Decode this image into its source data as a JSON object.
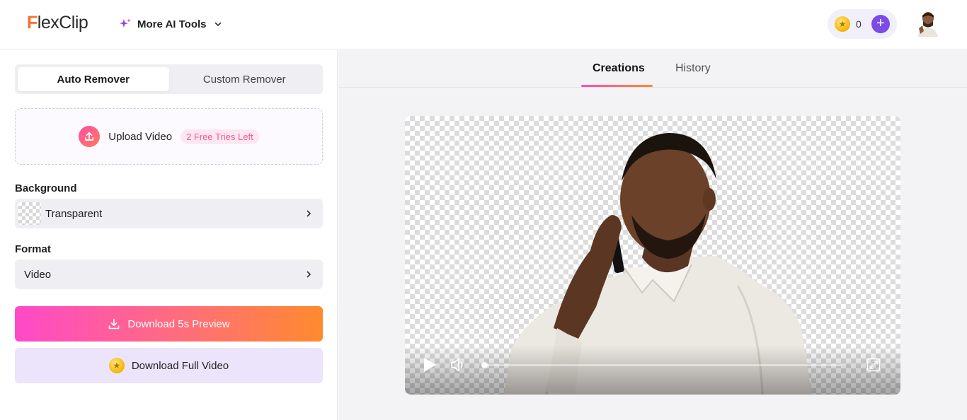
{
  "header": {
    "logo_first": "F",
    "logo_rest": "lexClip",
    "ai_tools_label": "More AI Tools",
    "credits_count": "0"
  },
  "left": {
    "remover_tabs": [
      {
        "label": "Auto Remover",
        "active": true
      },
      {
        "label": "Custom Remover",
        "active": false
      }
    ],
    "upload": {
      "label": "Upload Video",
      "badge": "2 Free Tries Left"
    },
    "background": {
      "section_label": "Background",
      "value": "Transparent"
    },
    "format": {
      "section_label": "Format",
      "value": "Video"
    },
    "download_preview_label": "Download 5s Preview",
    "download_full_label": "Download Full Video"
  },
  "right": {
    "tabs": [
      {
        "label": "Creations",
        "active": true
      },
      {
        "label": "History",
        "active": false
      }
    ],
    "player": {
      "progress": 0
    }
  },
  "colors": {
    "accent_purple": "#7b4be8",
    "gradient_pink": "#ff49c9",
    "gradient_orange": "#ff8a2d",
    "logo_orange": "#ff6b2d"
  },
  "icons": [
    "sparkle-icon",
    "chevron-down-icon",
    "coin-icon",
    "plus-icon",
    "upload-icon",
    "chevron-right-icon",
    "download-icon",
    "play-icon",
    "volume-icon",
    "fullscreen-icon"
  ]
}
